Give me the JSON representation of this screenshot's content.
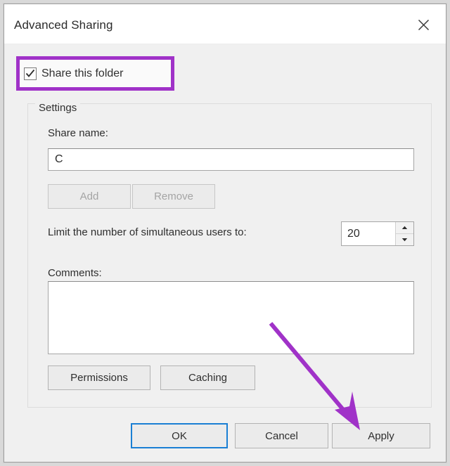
{
  "window": {
    "title": "Advanced Sharing",
    "close_icon": "close-icon"
  },
  "share_folder": {
    "label": "Share this folder",
    "checked": true,
    "highlight_color": "#a032c8"
  },
  "settings": {
    "legend": "Settings",
    "share_name": {
      "label": "Share name:",
      "value": "C",
      "placeholder": ""
    },
    "add_button": {
      "label": "Add",
      "enabled": false
    },
    "remove_button": {
      "label": "Remove",
      "enabled": false
    },
    "user_limit": {
      "label": "Limit the number of simultaneous users to:",
      "value": "20",
      "spin_up_icon": "spinner-up-icon",
      "spin_down_icon": "spinner-down-icon"
    },
    "comments": {
      "label": "Comments:",
      "value": "",
      "placeholder": ""
    },
    "permissions_button": "Permissions",
    "caching_button": "Caching"
  },
  "actions": {
    "ok": "OK",
    "cancel": "Cancel",
    "apply": "Apply",
    "focused": "OK",
    "focus_color": "#1a7fd4"
  },
  "annotations": {
    "arrow": {
      "name": "arrow-annotation",
      "color": "#a032c8",
      "points_to": "Apply"
    }
  }
}
